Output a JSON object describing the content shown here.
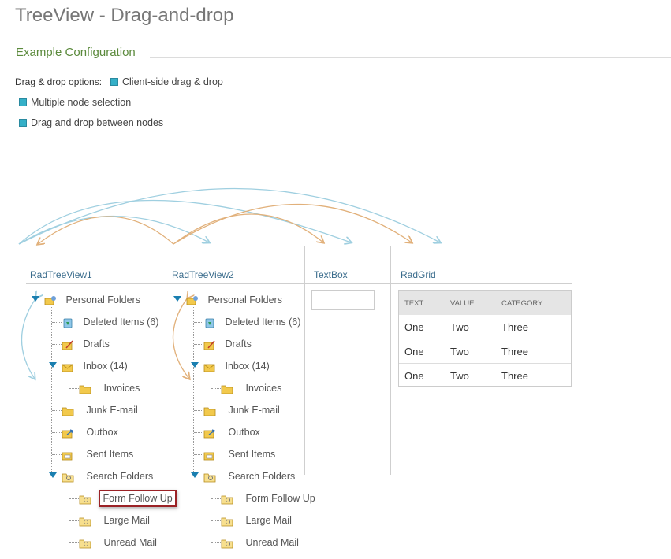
{
  "page": {
    "title": "TreeView - Drag-and-drop",
    "section": "Example Configuration"
  },
  "options": {
    "label": "Drag & drop options:",
    "client_side": "Client-side drag & drop",
    "multiple": "Multiple node selection",
    "between": "Drag and drop between nodes"
  },
  "columns": {
    "tree1": "RadTreeView1",
    "tree2": "RadTreeView2",
    "textbox": "TextBox",
    "grid": "RadGrid"
  },
  "tree": {
    "personal": "Personal Folders",
    "deleted": "Deleted Items (6)",
    "drafts": "Drafts",
    "inbox": "Inbox (14)",
    "invoices": "Invoices",
    "junk": "Junk E-mail",
    "outbox": "Outbox",
    "sent": "Sent Items",
    "search": "Search Folders",
    "followup": "Form Follow Up",
    "large": "Large Mail",
    "unread": "Unread Mail"
  },
  "grid": {
    "headers": [
      "TEXT",
      "VALUE",
      "CATEGORY"
    ],
    "rows": [
      [
        "One",
        "Two",
        "Three"
      ],
      [
        "One",
        "Two",
        "Three"
      ],
      [
        "One",
        "Two",
        "Three"
      ]
    ]
  },
  "icons": [
    "folder-icon",
    "personal-folders-icon",
    "recycle-bin-icon",
    "drafts-icon",
    "inbox-icon",
    "outbox-icon",
    "sent-items-icon",
    "search-folder-icon",
    "checkbox-icon",
    "expand-toggle-icon",
    "drag-arrow-icon"
  ],
  "colors": {
    "checkbox": "#35b0c8",
    "title": "#777777",
    "section": "#5b8a3c",
    "highlight": "#9b2226",
    "arrow_blue": "#9fcfe0",
    "arrow_orange": "#e1b07a",
    "folder": "#f2c94c"
  }
}
